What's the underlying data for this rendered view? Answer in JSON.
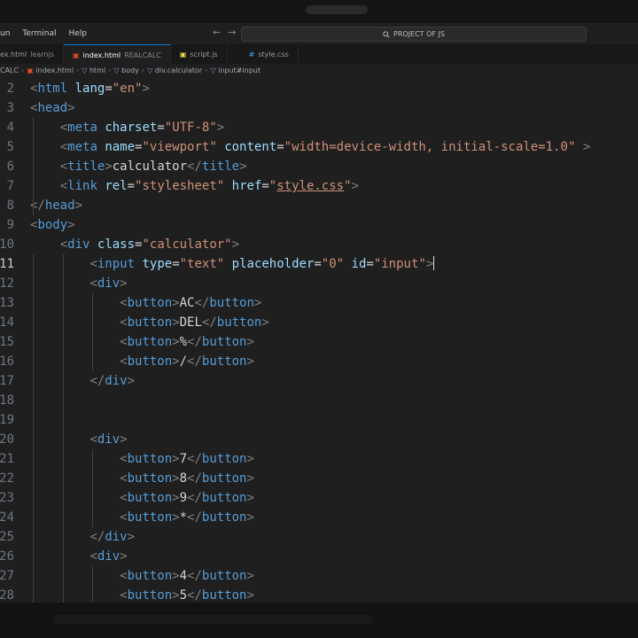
{
  "menu": [
    "un",
    "Terminal",
    "Help"
  ],
  "command_center": {
    "icon": "search-icon",
    "label": "PROJECT OF JS"
  },
  "tabs": [
    {
      "name": "ex.html",
      "desc": "learnjs",
      "icon": "html-file-icon",
      "active": false
    },
    {
      "name": "index.html",
      "desc": "REALCALC",
      "icon": "html-file-icon",
      "active": true
    },
    {
      "name": "script.js",
      "desc": "",
      "icon": "js-file-icon",
      "active": false
    },
    {
      "name": "style.css",
      "desc": "",
      "icon": "css-file-icon",
      "active": false
    }
  ],
  "breadcrumb": [
    "CALC",
    "index.html",
    "html",
    "body",
    "div.calculator",
    "input#input"
  ],
  "editor": {
    "current_line": "11",
    "lines": [
      {
        "n": "2",
        "indent": 0,
        "t": [
          [
            "t",
            "<"
          ],
          [
            "tag",
            "html"
          ],
          [
            "txt",
            " "
          ],
          [
            "attr",
            "lang"
          ],
          [
            "txt",
            "="
          ],
          [
            "str",
            "\"en\""
          ],
          [
            "t",
            ">"
          ]
        ]
      },
      {
        "n": "3",
        "indent": 0,
        "t": [
          [
            "t",
            "<"
          ],
          [
            "tag",
            "head"
          ],
          [
            "t",
            ">"
          ]
        ]
      },
      {
        "n": "4",
        "indent": 1,
        "t": [
          [
            "t",
            "<"
          ],
          [
            "tag",
            "meta"
          ],
          [
            "txt",
            " "
          ],
          [
            "attr",
            "charset"
          ],
          [
            "txt",
            "="
          ],
          [
            "str",
            "\"UTF-8\""
          ],
          [
            "t",
            ">"
          ]
        ]
      },
      {
        "n": "5",
        "indent": 1,
        "t": [
          [
            "t",
            "<"
          ],
          [
            "tag",
            "meta"
          ],
          [
            "txt",
            " "
          ],
          [
            "attr",
            "name"
          ],
          [
            "txt",
            "="
          ],
          [
            "str",
            "\"viewport\""
          ],
          [
            "txt",
            " "
          ],
          [
            "attr",
            "content"
          ],
          [
            "txt",
            "="
          ],
          [
            "str",
            "\"width=device-width, initial-scale=1.0\""
          ],
          [
            "txt",
            " "
          ],
          [
            "t",
            ">"
          ]
        ]
      },
      {
        "n": "6",
        "indent": 1,
        "t": [
          [
            "t",
            "<"
          ],
          [
            "tag",
            "title"
          ],
          [
            "t",
            ">"
          ],
          [
            "txt",
            "calculator"
          ],
          [
            "t",
            "</"
          ],
          [
            "tag",
            "title"
          ],
          [
            "t",
            ">"
          ]
        ]
      },
      {
        "n": "7",
        "indent": 1,
        "t": [
          [
            "t",
            "<"
          ],
          [
            "tag",
            "link"
          ],
          [
            "txt",
            " "
          ],
          [
            "attr",
            "rel"
          ],
          [
            "txt",
            "="
          ],
          [
            "str",
            "\"stylesheet\""
          ],
          [
            "txt",
            " "
          ],
          [
            "attr",
            "href"
          ],
          [
            "txt",
            "="
          ],
          [
            "str",
            "\""
          ],
          [
            "link",
            "style.css"
          ],
          [
            "str",
            "\""
          ],
          [
            "t",
            ">"
          ]
        ]
      },
      {
        "n": "8",
        "indent": 0,
        "t": [
          [
            "t",
            "</"
          ],
          [
            "tag",
            "head"
          ],
          [
            "t",
            ">"
          ]
        ]
      },
      {
        "n": "9",
        "indent": 0,
        "t": [
          [
            "t",
            "<"
          ],
          [
            "tag",
            "body"
          ],
          [
            "t",
            ">"
          ]
        ]
      },
      {
        "n": "10",
        "indent": 1,
        "t": [
          [
            "t",
            "<"
          ],
          [
            "tag",
            "div"
          ],
          [
            "txt",
            " "
          ],
          [
            "attr",
            "class"
          ],
          [
            "txt",
            "="
          ],
          [
            "str",
            "\"calculator\""
          ],
          [
            "t",
            ">"
          ]
        ]
      },
      {
        "n": "11",
        "indent": 2,
        "t": [
          [
            "t",
            "<"
          ],
          [
            "tag",
            "input"
          ],
          [
            "txt",
            " "
          ],
          [
            "attr",
            "type"
          ],
          [
            "txt",
            "="
          ],
          [
            "str",
            "\"text\""
          ],
          [
            "txt",
            " "
          ],
          [
            "attr",
            "placeholder"
          ],
          [
            "txt",
            "="
          ],
          [
            "str",
            "\"0\""
          ],
          [
            "txt",
            " "
          ],
          [
            "attr",
            "id"
          ],
          [
            "txt",
            "="
          ],
          [
            "str",
            "\"input\""
          ],
          [
            "t",
            ">"
          ]
        ]
      },
      {
        "n": "12",
        "indent": 2,
        "t": [
          [
            "t",
            "<"
          ],
          [
            "tag",
            "div"
          ],
          [
            "t",
            ">"
          ]
        ]
      },
      {
        "n": "13",
        "indent": 3,
        "t": [
          [
            "t",
            "<"
          ],
          [
            "tag",
            "button"
          ],
          [
            "t",
            ">"
          ],
          [
            "txt",
            "AC"
          ],
          [
            "t",
            "</"
          ],
          [
            "tag",
            "button"
          ],
          [
            "t",
            ">"
          ]
        ]
      },
      {
        "n": "14",
        "indent": 3,
        "t": [
          [
            "t",
            "<"
          ],
          [
            "tag",
            "button"
          ],
          [
            "t",
            ">"
          ],
          [
            "txt",
            "DEL"
          ],
          [
            "t",
            "</"
          ],
          [
            "tag",
            "button"
          ],
          [
            "t",
            ">"
          ]
        ]
      },
      {
        "n": "15",
        "indent": 3,
        "t": [
          [
            "t",
            "<"
          ],
          [
            "tag",
            "button"
          ],
          [
            "t",
            ">"
          ],
          [
            "txt",
            "%"
          ],
          [
            "t",
            "</"
          ],
          [
            "tag",
            "button"
          ],
          [
            "t",
            ">"
          ]
        ]
      },
      {
        "n": "16",
        "indent": 3,
        "t": [
          [
            "t",
            "<"
          ],
          [
            "tag",
            "button"
          ],
          [
            "t",
            ">"
          ],
          [
            "txt",
            "/"
          ],
          [
            "t",
            "</"
          ],
          [
            "tag",
            "button"
          ],
          [
            "t",
            ">"
          ]
        ]
      },
      {
        "n": "17",
        "indent": 2,
        "t": [
          [
            "t",
            "</"
          ],
          [
            "tag",
            "div"
          ],
          [
            "t",
            ">"
          ]
        ]
      },
      {
        "n": "18",
        "indent": 0,
        "t": []
      },
      {
        "n": "19",
        "indent": 0,
        "t": []
      },
      {
        "n": "20",
        "indent": 2,
        "t": [
          [
            "t",
            "<"
          ],
          [
            "tag",
            "div"
          ],
          [
            "t",
            ">"
          ]
        ]
      },
      {
        "n": "21",
        "indent": 3,
        "t": [
          [
            "t",
            "<"
          ],
          [
            "tag",
            "button"
          ],
          [
            "t",
            ">"
          ],
          [
            "txt",
            "7"
          ],
          [
            "t",
            "</"
          ],
          [
            "tag",
            "button"
          ],
          [
            "t",
            ">"
          ]
        ]
      },
      {
        "n": "22",
        "indent": 3,
        "t": [
          [
            "t",
            "<"
          ],
          [
            "tag",
            "button"
          ],
          [
            "t",
            ">"
          ],
          [
            "txt",
            "8"
          ],
          [
            "t",
            "</"
          ],
          [
            "tag",
            "button"
          ],
          [
            "t",
            ">"
          ]
        ]
      },
      {
        "n": "23",
        "indent": 3,
        "t": [
          [
            "t",
            "<"
          ],
          [
            "tag",
            "button"
          ],
          [
            "t",
            ">"
          ],
          [
            "txt",
            "9"
          ],
          [
            "t",
            "</"
          ],
          [
            "tag",
            "button"
          ],
          [
            "t",
            ">"
          ]
        ]
      },
      {
        "n": "24",
        "indent": 3,
        "t": [
          [
            "t",
            "<"
          ],
          [
            "tag",
            "button"
          ],
          [
            "t",
            ">"
          ],
          [
            "txt",
            "*"
          ],
          [
            "t",
            "</"
          ],
          [
            "tag",
            "button"
          ],
          [
            "t",
            ">"
          ]
        ]
      },
      {
        "n": "25",
        "indent": 2,
        "t": [
          [
            "t",
            "</"
          ],
          [
            "tag",
            "div"
          ],
          [
            "t",
            ">"
          ]
        ]
      },
      {
        "n": "26",
        "indent": 2,
        "t": [
          [
            "t",
            "<"
          ],
          [
            "tag",
            "div"
          ],
          [
            "t",
            ">"
          ]
        ]
      },
      {
        "n": "27",
        "indent": 3,
        "t": [
          [
            "t",
            "<"
          ],
          [
            "tag",
            "button"
          ],
          [
            "t",
            ">"
          ],
          [
            "txt",
            "4"
          ],
          [
            "t",
            "</"
          ],
          [
            "tag",
            "button"
          ],
          [
            "t",
            ">"
          ]
        ]
      },
      {
        "n": "28",
        "indent": 3,
        "t": [
          [
            "t",
            "<"
          ],
          [
            "tag",
            "button"
          ],
          [
            "t",
            ">"
          ],
          [
            "txt",
            "5"
          ],
          [
            "t",
            "</"
          ],
          [
            "tag",
            "button"
          ],
          [
            "t",
            ">"
          ]
        ]
      }
    ]
  }
}
